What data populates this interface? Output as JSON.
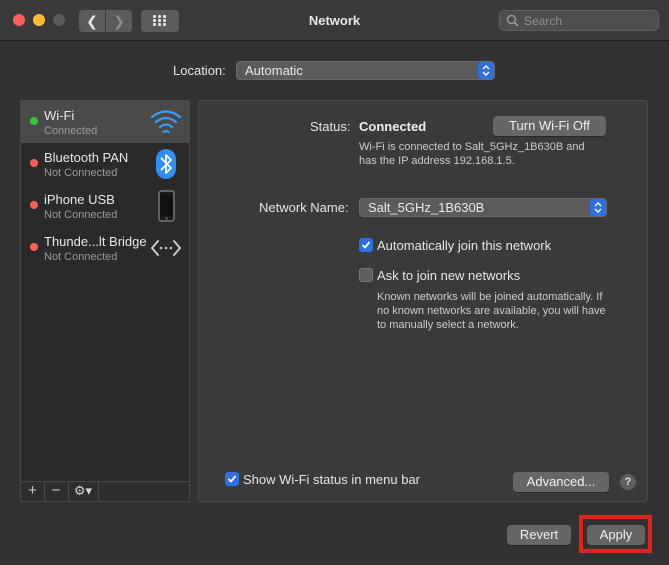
{
  "window": {
    "title": "Network"
  },
  "search": {
    "placeholder": "Search"
  },
  "location": {
    "label": "Location:",
    "value": "Automatic"
  },
  "services": [
    {
      "name": "Wi-Fi",
      "state": "Connected",
      "status_color": "#2dc940",
      "icon": "wifi-icon",
      "selected": true
    },
    {
      "name": "Bluetooth PAN",
      "state": "Not Connected",
      "status_color": "#fe5f57",
      "icon": "bluetooth-icon",
      "selected": false
    },
    {
      "name": "iPhone USB",
      "state": "Not Connected",
      "status_color": "#fe5f57",
      "icon": "iphone-icon",
      "selected": false
    },
    {
      "name": "Thunde...lt Bridge",
      "state": "Not Connected",
      "status_color": "#fe5f57",
      "icon": "thunderbolt-bridge-icon",
      "selected": false
    }
  ],
  "sidebar_tools": {
    "add": "+",
    "remove": "−",
    "gear": "⚙▾"
  },
  "detail": {
    "status_label": "Status:",
    "status_value": "Connected",
    "turn_off_label": "Turn Wi-Fi Off",
    "status_desc_line1": "Wi-Fi is connected to Salt_5GHz_1B630B and",
    "status_desc_line2": "has the IP address 192.168.1.5.",
    "network_name_label": "Network Name:",
    "network_name_value": "Salt_5GHz_1B630B",
    "auto_join_label": "Automatically join this network",
    "auto_join_checked": true,
    "ask_join_label": "Ask to join new networks",
    "ask_join_checked": false,
    "ask_desc_line1": "Known networks will be joined automatically. If",
    "ask_desc_line2": "no known networks are available, you will have",
    "ask_desc_line3": "to manually select a network.",
    "show_menubar_label": "Show Wi-Fi status in menu bar",
    "show_menubar_checked": true,
    "advanced_label": "Advanced...",
    "help_label": "?"
  },
  "footer": {
    "revert_label": "Revert",
    "apply_label": "Apply"
  },
  "colors": {
    "accent": "#2f6fe0",
    "highlight": "#e0241a"
  }
}
